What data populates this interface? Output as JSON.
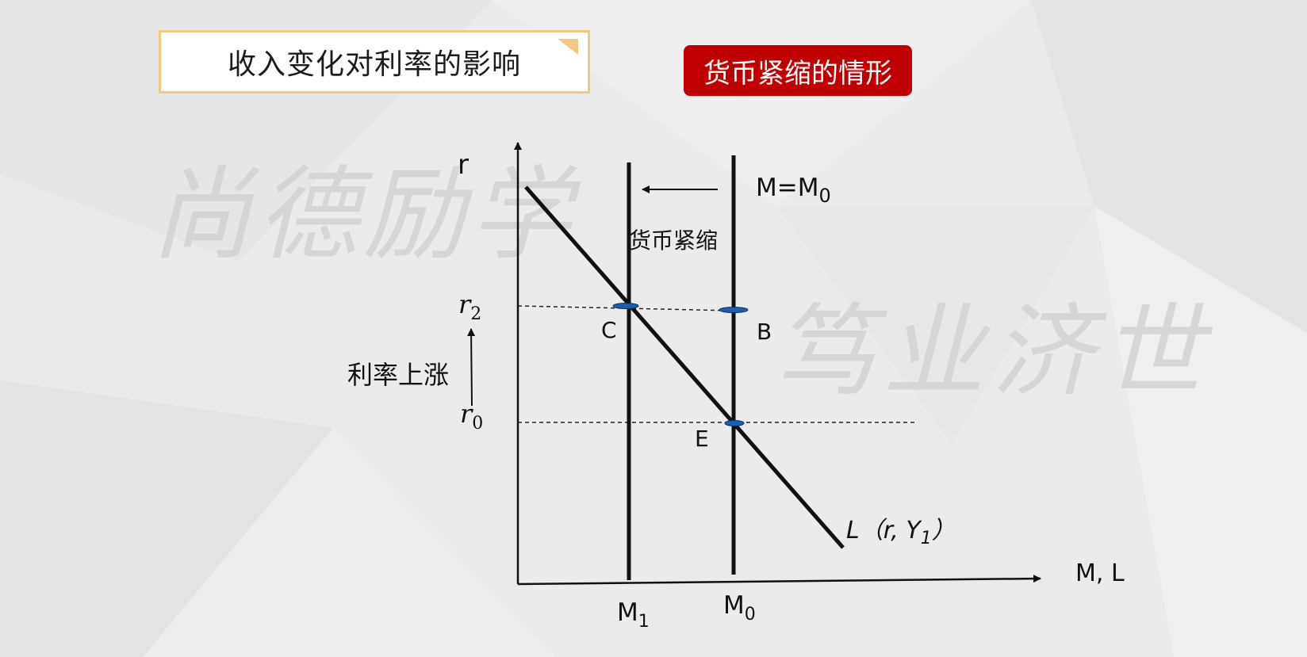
{
  "title": "收入变化对利率的影响",
  "tag": "货币紧缩的情形",
  "watermark": {
    "left": "尚德励学",
    "right": "笃业济世"
  },
  "colors": {
    "accent": "#c00000",
    "title_border": "#f3c887",
    "point": "#1a5fb4"
  },
  "diagram": {
    "y_axis_label": "r",
    "x_axis_label": "M, L",
    "money_supply_label": {
      "main": "M=M",
      "sub": "0"
    },
    "shift_label": "货币紧缩",
    "demand_curve_label": {
      "L": "L",
      "open": "（r, ",
      "Y": "Y",
      "sub": "1",
      "close": "）"
    },
    "rate_rise_label": "利率上涨",
    "r2": {
      "main": "r",
      "sub": "2"
    },
    "r0": {
      "main": "r",
      "sub": "0"
    },
    "M1": {
      "main": "M",
      "sub": "1"
    },
    "M0": {
      "main": "M",
      "sub": "0"
    },
    "point_C": "C",
    "point_B": "B",
    "point_E": "E"
  }
}
